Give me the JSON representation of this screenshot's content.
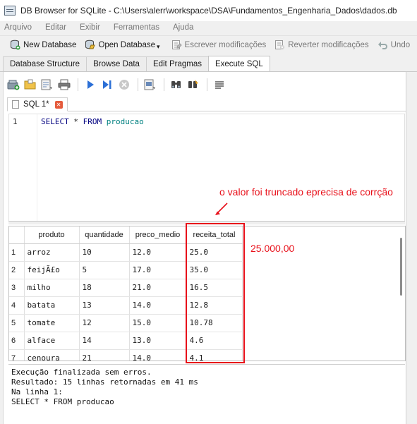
{
  "window": {
    "title": "DB Browser for SQLite - C:\\Users\\alerr\\workspace\\DSA\\Fundamentos_Engenharia_Dados\\dados.db"
  },
  "menu": [
    "Arquivo",
    "Editar",
    "Exibir",
    "Ferramentas",
    "Ajuda"
  ],
  "toolbar": {
    "new_database": "New Database",
    "open_database": "Open Database",
    "write_changes": "Escrever modificações",
    "revert_changes": "Reverter modificações",
    "undo": "Undo"
  },
  "tabs": [
    "Database Structure",
    "Browse Data",
    "Edit Pragmas",
    "Execute SQL"
  ],
  "active_tab": "Execute SQL",
  "sql_tab": {
    "label": "SQL 1*"
  },
  "editor": {
    "line_number": "1",
    "kw_select": "SELECT",
    "star": " * ",
    "kw_from": "FROM",
    "table": " producao"
  },
  "results": {
    "columns": [
      "produto",
      "quantidade",
      "preco_medio",
      "receita_total"
    ],
    "rows": [
      {
        "n": "1",
        "produto": "arroz",
        "quantidade": "10",
        "preco_medio": "12.0",
        "receita_total": "25.0"
      },
      {
        "n": "2",
        "produto": "feijÃ£o",
        "quantidade": "5",
        "preco_medio": "17.0",
        "receita_total": "35.0"
      },
      {
        "n": "3",
        "produto": "milho",
        "quantidade": "18",
        "preco_medio": "21.0",
        "receita_total": "16.5"
      },
      {
        "n": "4",
        "produto": "batata",
        "quantidade": "13",
        "preco_medio": "14.0",
        "receita_total": "12.8"
      },
      {
        "n": "5",
        "produto": "tomate",
        "quantidade": "12",
        "preco_medio": "15.0",
        "receita_total": "10.78"
      },
      {
        "n": "6",
        "produto": "alface",
        "quantidade": "14",
        "preco_medio": "13.0",
        "receita_total": "4.6"
      },
      {
        "n": "7",
        "produto": "cenoura",
        "quantidade": "21",
        "preco_medio": "14.0",
        "receita_total": "4.1"
      }
    ]
  },
  "annotations": {
    "note": "o valor foi truncado eprecisa de corrção",
    "value": "25.000,00",
    "plus": "+",
    "color": "#e8101a"
  },
  "log": {
    "line1": "Execução finalizada sem erros.",
    "line2": "Resultado: 15 linhas retornadas em 41 ms",
    "line3": "Na linha 1:",
    "line4": "SELECT * FROM producao"
  }
}
